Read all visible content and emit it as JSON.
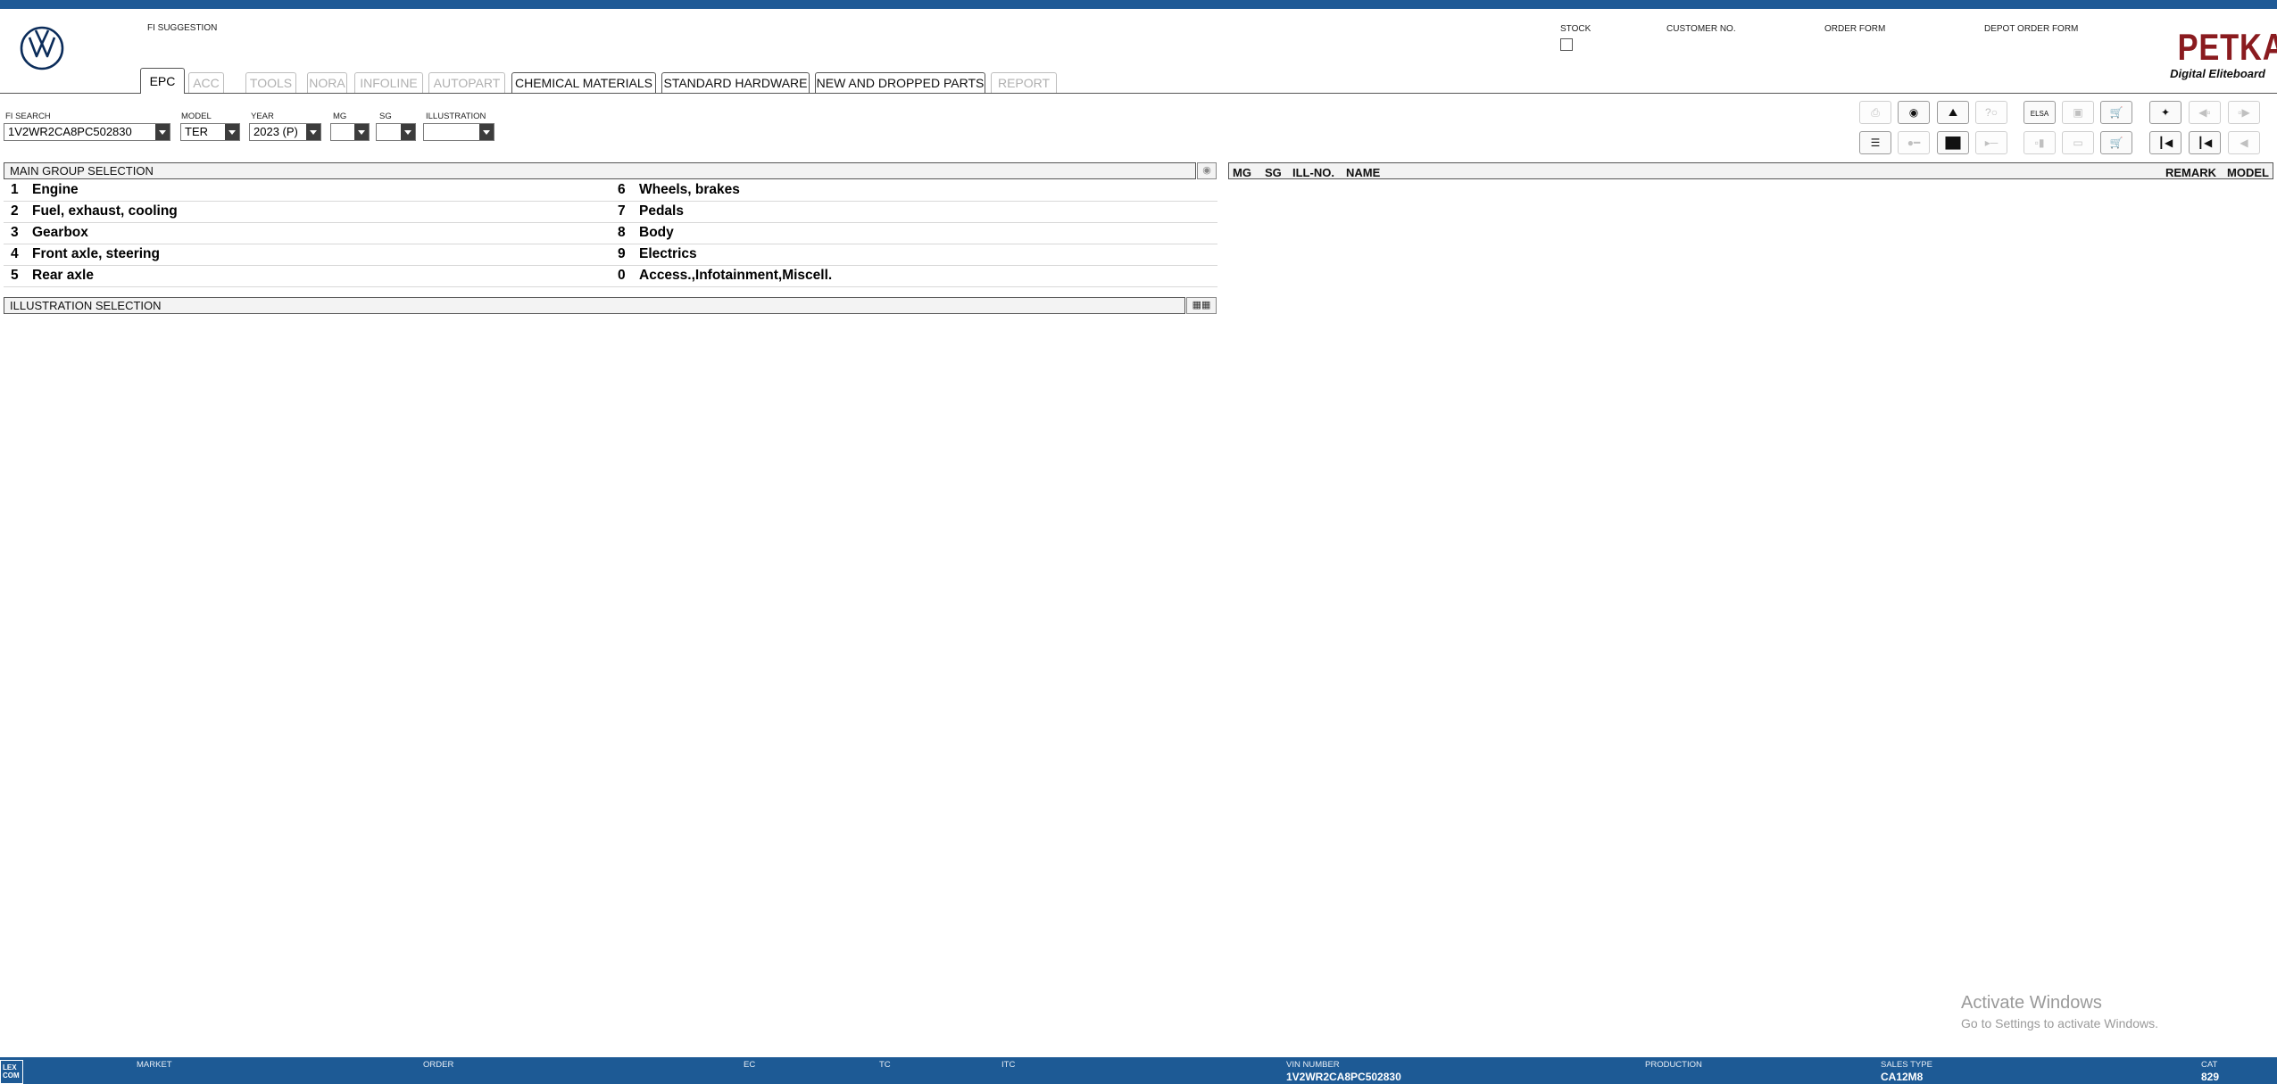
{
  "header": {
    "fi_suggestion_label": "FI SUGGESTION",
    "stock_label": "STOCK",
    "customer_no_label": "CUSTOMER NO.",
    "order_form_label": "ORDER FORM",
    "depot_order_form_label": "DEPOT ORDER FORM",
    "brand": "PETKA",
    "brand_sub": "Digital Eliteboard",
    "stock_checked": false
  },
  "tabs": [
    {
      "label": "EPC",
      "state": "active"
    },
    {
      "label": "ACC",
      "state": "disabled"
    },
    {
      "label": "TOOLS",
      "state": "disabled"
    },
    {
      "label": "NORA",
      "state": "disabled"
    },
    {
      "label": "INFOLINE",
      "state": "disabled"
    },
    {
      "label": "AUTOPART",
      "state": "disabled"
    },
    {
      "label": "CHEMICAL MATERIALS",
      "state": "enabled"
    },
    {
      "label": "STANDARD HARDWARE",
      "state": "enabled"
    },
    {
      "label": "NEW AND DROPPED PARTS",
      "state": "enabled"
    },
    {
      "label": "REPORT",
      "state": "disabled"
    }
  ],
  "filters": {
    "fi_search_label": "FI SEARCH",
    "fi_search_value": "1V2WR2CA8PC502830",
    "model_label": "MODEL",
    "model_value": "TER",
    "year_label": "YEAR",
    "year_value": "2023 (P)",
    "mg_label": "MG",
    "mg_value": "",
    "sg_label": "SG",
    "sg_value": "",
    "illustration_label": "ILLUSTRATION",
    "illustration_value": ""
  },
  "toolbar": {
    "elsa_label": "ELSA",
    "icons": [
      "print-icon",
      "parts-disc-icon",
      "car-icon",
      "question-icon",
      "elsa-icon",
      "compare-icon",
      "cart-add-icon",
      "pin-icon",
      "prev-page-icon",
      "next-page-icon",
      "list-icon",
      "key-icon",
      "tree-icon",
      "toggle-icon",
      "doc-icon",
      "screen-icon",
      "cart-icon",
      "first-icon",
      "prev-icon",
      "back-icon"
    ]
  },
  "main_group": {
    "title": "MAIN GROUP SELECTION",
    "left": [
      {
        "num": "1",
        "name": "Engine"
      },
      {
        "num": "2",
        "name": "Fuel, exhaust, cooling"
      },
      {
        "num": "3",
        "name": "Gearbox"
      },
      {
        "num": "4",
        "name": "Front axle, steering"
      },
      {
        "num": "5",
        "name": "Rear axle"
      }
    ],
    "right": [
      {
        "num": "6",
        "name": "Wheels, brakes"
      },
      {
        "num": "7",
        "name": "Pedals"
      },
      {
        "num": "8",
        "name": "Body"
      },
      {
        "num": "9",
        "name": "Electrics"
      },
      {
        "num": "0",
        "name": "Access.,Infotainment,Miscell."
      }
    ]
  },
  "illustration_section": {
    "title": "ILLUSTRATION SELECTION"
  },
  "parts_table": {
    "columns": {
      "mg": "MG",
      "sg": "SG",
      "ill_no": "ILL-NO.",
      "name": "NAME",
      "remark": "REMARK",
      "model": "MODEL"
    }
  },
  "watermark": {
    "line1": "Activate Windows",
    "line2": "Go to Settings to activate Windows."
  },
  "statusbar": {
    "logo_text_1": "LEX",
    "logo_text_2": "COM",
    "market_label": "MARKET",
    "order_label": "ORDER",
    "ec_label": "EC",
    "tc_label": "TC",
    "itc_label": "ITC",
    "vin_label": "VIN NUMBER",
    "vin_value": "1V2WR2CA8PC502830",
    "production_label": "PRODUCTION",
    "sales_type_label": "SALES TYPE",
    "sales_type_value": "CA12M8",
    "cat_label": "CAT",
    "cat_value": "829"
  },
  "colors": {
    "brand_blue": "#1d5a95",
    "petka_red": "#8a1b1f"
  }
}
